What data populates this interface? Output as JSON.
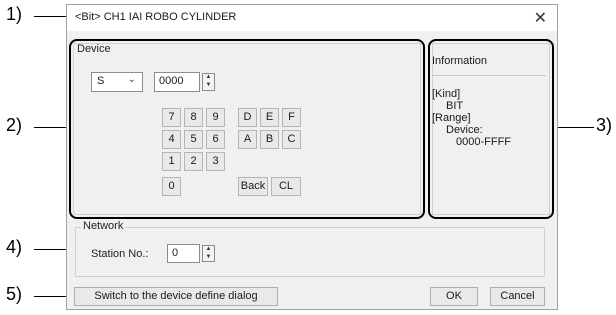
{
  "callouts": [
    "1)",
    "2)",
    "3)",
    "4)",
    "5)"
  ],
  "dialog": {
    "title": "<Bit> CH1 IAI ROBO CYLINDER",
    "close_label": "✕"
  },
  "device": {
    "group_label": "Device",
    "device_type": "S",
    "address": "0000",
    "keys_row1": [
      "7",
      "8",
      "9",
      "D",
      "E",
      "F"
    ],
    "keys_row2": [
      "4",
      "5",
      "6",
      "A",
      "B",
      "C"
    ],
    "keys_row3": [
      "1",
      "2",
      "3"
    ],
    "key_zero": "0",
    "back_label": "Back",
    "clear_label": "CL"
  },
  "information": {
    "title": "Information",
    "kind_label": "[Kind]",
    "kind_value": "BIT",
    "range_label": "[Range]",
    "device_label": "Device:",
    "range_value": "0000-FFFF"
  },
  "network": {
    "group_label": "Network",
    "station_label": "Station No.:",
    "station_value": "0"
  },
  "footer": {
    "switch_label": "Switch to the device define dialog",
    "ok_label": "OK",
    "cancel_label": "Cancel"
  }
}
